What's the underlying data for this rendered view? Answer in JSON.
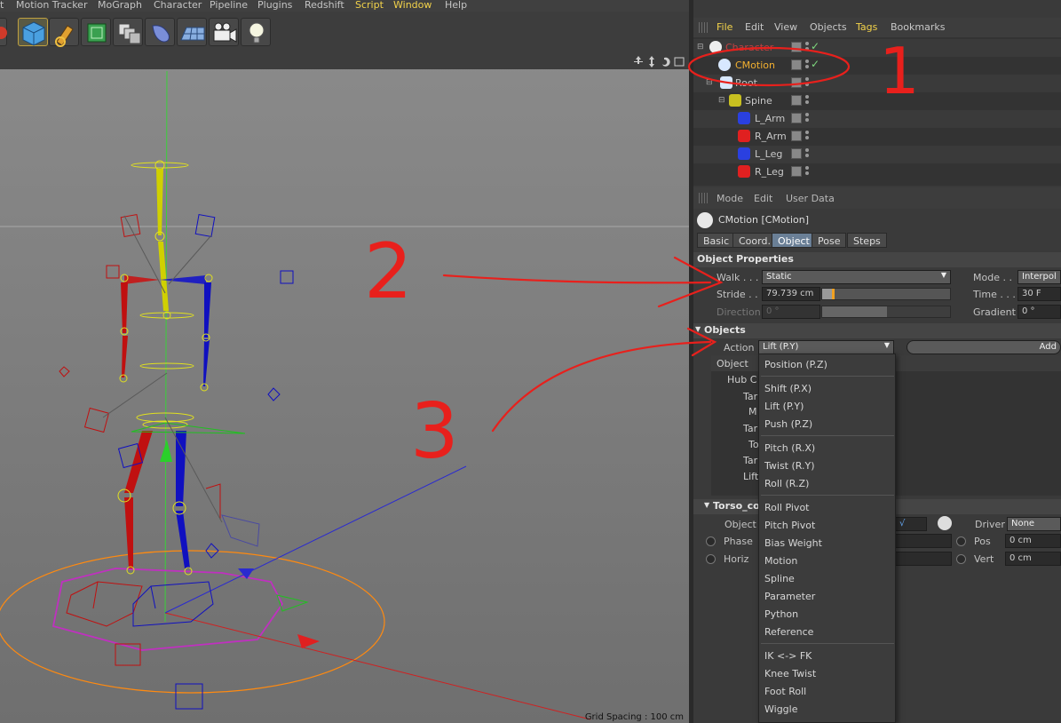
{
  "menubar": {
    "items": [
      {
        "label": "t",
        "highlight": false
      },
      {
        "label": "Motion Tracker",
        "highlight": false
      },
      {
        "label": "MoGraph",
        "highlight": false
      },
      {
        "label": "Character",
        "highlight": false
      },
      {
        "label": "Pipeline",
        "highlight": false
      },
      {
        "label": "Plugins",
        "highlight": false
      },
      {
        "label": "Redshift",
        "highlight": false
      },
      {
        "label": "Script",
        "highlight": true
      },
      {
        "label": "Window",
        "highlight": true
      },
      {
        "label": "Help",
        "highlight": false
      }
    ]
  },
  "toolbar": {
    "buttons": [
      "record-icon",
      "cube-icon",
      "pen-icon",
      "subdivision-icon",
      "array-icon",
      "deformer-icon",
      "floor-icon",
      "camera-icon",
      "light-icon"
    ]
  },
  "viewport": {
    "grid_spacing": "Grid Spacing : 100 cm"
  },
  "object_manager": {
    "menu": [
      "File",
      "Edit",
      "View",
      "Objects",
      "Tags",
      "Bookmarks"
    ],
    "objects": [
      {
        "name": "Character",
        "indent": 0,
        "icon": "character-icon",
        "check": true
      },
      {
        "name": "CMotion",
        "indent": 1,
        "icon": "cmotion-icon",
        "check": true
      },
      {
        "name": "Root",
        "indent": 1,
        "icon": "joint-icon",
        "check": false
      },
      {
        "name": "Spine",
        "indent": 2,
        "icon": "spine-icon",
        "check": false
      },
      {
        "name": "L_Arm",
        "indent": 3,
        "icon": "arm-icon",
        "check": false
      },
      {
        "name": "R_Arm",
        "indent": 3,
        "icon": "arm-icon",
        "check": false
      },
      {
        "name": "L_Leg",
        "indent": 3,
        "icon": "leg-icon",
        "check": false
      },
      {
        "name": "R_Leg",
        "indent": 3,
        "icon": "leg-icon",
        "check": false
      }
    ]
  },
  "attribute_manager": {
    "menu": [
      "Mode",
      "Edit",
      "User Data"
    ],
    "object_title": "CMotion [CMotion]",
    "tabs": [
      {
        "label": "Basic",
        "active": false
      },
      {
        "label": "Coord.",
        "active": false
      },
      {
        "label": "Object",
        "active": true
      },
      {
        "label": "Pose",
        "active": false
      },
      {
        "label": "Steps",
        "active": false
      }
    ],
    "object_properties": {
      "header": "Object Properties",
      "walk_label": "Walk . . .",
      "walk_value": "Static",
      "stride_label": "Stride . .",
      "stride_value": "79.739 cm",
      "direction_label": "Direction",
      "direction_value": "0 °",
      "mode_label": "Mode . .",
      "mode_value": "Interpol",
      "time_label": "Time . . .",
      "time_value": "30 F",
      "gradient_label": "Gradient",
      "gradient_value": "0 °"
    },
    "objects_section": {
      "header": "Objects",
      "action_label": "Action",
      "action_value": "Lift (P.Y)",
      "add_label": "Add",
      "tree_header": "Object",
      "tree_items": [
        "Hub C",
        "Tar",
        "M",
        "Tar",
        "To",
        "Tar",
        "Lift"
      ]
    },
    "torso_section": {
      "header": "Torso_cor",
      "object_label": "Object",
      "phase_label": "Phase",
      "horiz_label": "Horiz",
      "driver_label": "Driver",
      "driver_value": "None",
      "pos_label": "Pos",
      "pos_value": "0 cm",
      "vert_label": "Vert",
      "vert_value": "0 cm"
    }
  },
  "dropdown": {
    "groups": [
      [
        "Position (P.Z)"
      ],
      [
        "Shift (P.X)",
        "Lift (P.Y)",
        "Push (P.Z)"
      ],
      [
        "Pitch (R.X)",
        "Twist (R.Y)",
        "Roll (R.Z)"
      ],
      [
        "Roll Pivot",
        "Pitch Pivot",
        "Bias Weight",
        "Motion",
        "Spline",
        "Parameter",
        "Python",
        "Reference"
      ],
      [
        "IK <-> FK",
        "Knee Twist",
        "Foot Roll",
        "Wiggle"
      ]
    ]
  },
  "annotations": {
    "numbers": [
      "1",
      "2",
      "3"
    ],
    "color": "#e8201c"
  },
  "colors": {
    "accent_yellow": "#f2d24a",
    "tab_active": "#6a7f96",
    "stride_bar": "#f0a020"
  }
}
